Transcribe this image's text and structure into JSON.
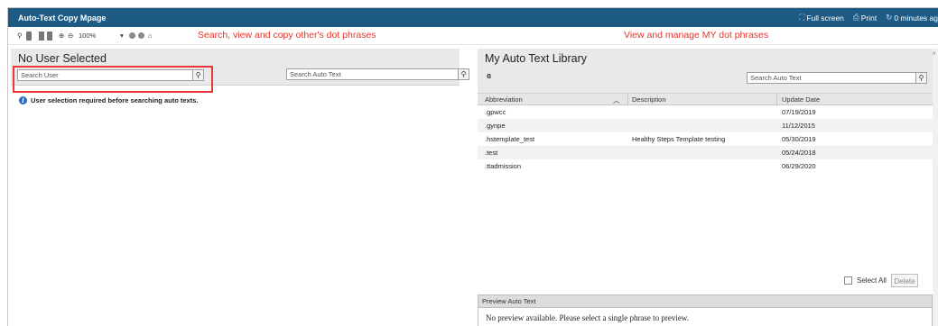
{
  "window": {
    "title": "Auto-Text Copy Mpage"
  },
  "titlebar": {
    "full_screen": "Full screen",
    "print": "Print",
    "refresh": "0 minutes ag"
  },
  "toolbar": {
    "zoom": "100%"
  },
  "annotations": {
    "left": "Search, view and copy other's dot phrases",
    "right": "View and manage MY dot phrases"
  },
  "left_panel": {
    "title": "No User Selected",
    "search_user_placeholder": "Search User",
    "search_auto_text_placeholder": "Search Auto Text",
    "info_message": "User selection required before searching auto texts."
  },
  "right_panel": {
    "title": "My Auto Text Library",
    "search_placeholder": "Search Auto Text",
    "columns": {
      "abbreviation": "Abbreviation",
      "description": "Description",
      "update_date": "Update Date"
    },
    "rows": [
      {
        "abbreviation": ".gpwcc",
        "description": "",
        "update_date": "07/19/2019"
      },
      {
        "abbreviation": ".gynpe",
        "description": "",
        "update_date": "11/12/2015"
      },
      {
        "abbreviation": ".hstemplate_test",
        "description": "Healthy Steps Template testing",
        "update_date": "05/30/2019"
      },
      {
        "abbreviation": ".test",
        "description": "",
        "update_date": "05/24/2018"
      },
      {
        "abbreviation": ".ttadmission",
        "description": "",
        "update_date": "06/29/2020"
      }
    ],
    "select_all": "Select All",
    "delete": "Delete",
    "preview_header": "Preview Auto Text",
    "preview_text": "No preview available. Please select a single phrase to preview."
  },
  "colors": {
    "titlebar": "#1d5a84",
    "annotation": "#e0362c",
    "highlight_box": "#e8363a"
  }
}
